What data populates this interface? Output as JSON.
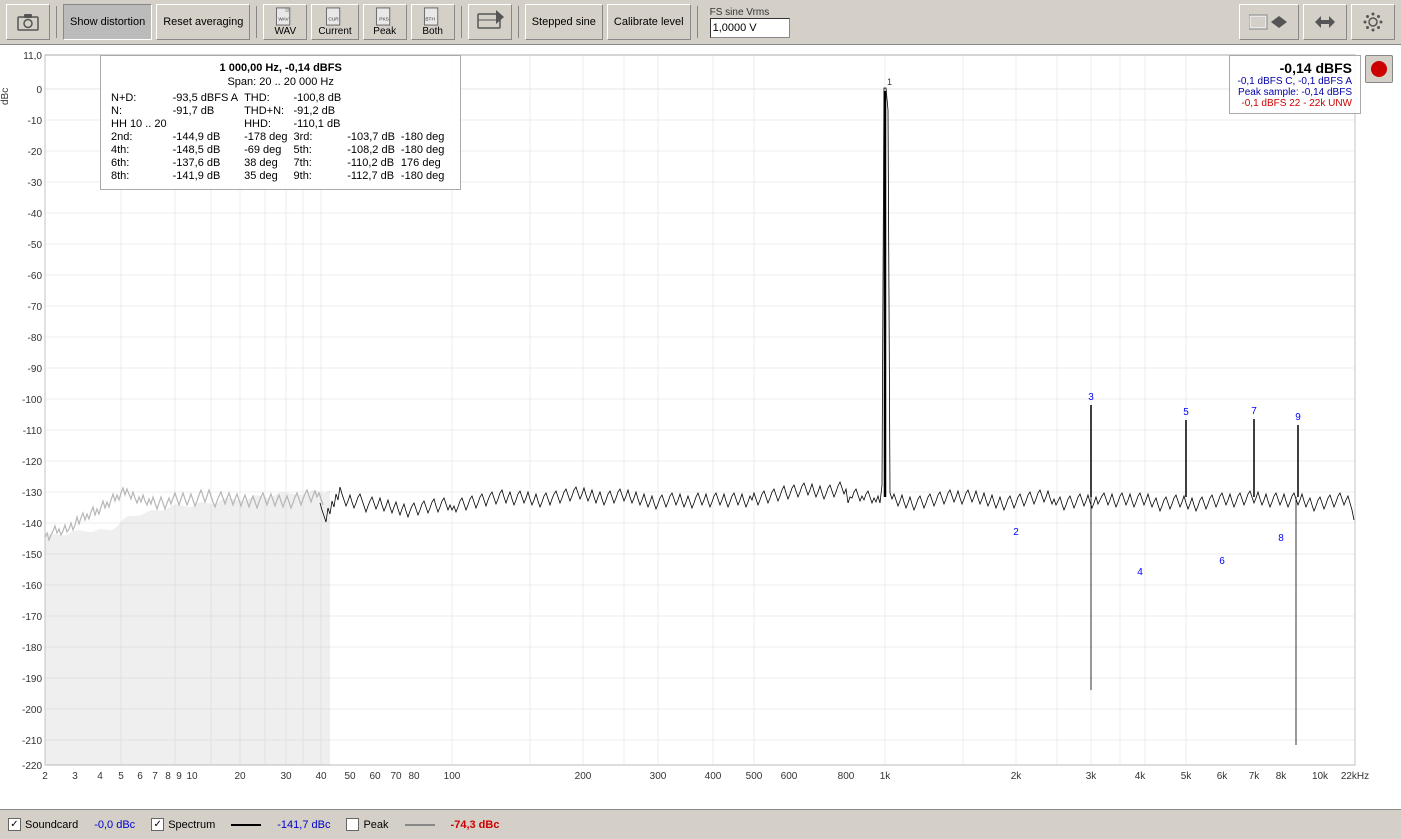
{
  "toolbar": {
    "show_distortion_label": "Show distortion",
    "reset_averaging_label": "Reset averaging",
    "wav_label": "WAV",
    "current_label": "Current",
    "peak_label": "Peak",
    "both_label": "Both",
    "stepped_sine_label": "Stepped sine",
    "calibrate_level_label": "Calibrate level",
    "fs_sine_label": "FS sine Vrms",
    "fs_value": "1,0000 V"
  },
  "info_box": {
    "title": "1 000,00 Hz, -0,14 dBFS",
    "span": "Span: 20 .. 20 000 Hz",
    "nd_label": "N+D:",
    "nd_value": "-93,5 dBFS A",
    "thd_label": "THD:",
    "thd_value": "-100,8 dB",
    "n_label": "N:",
    "n_value": "-91,7 dB",
    "thdn_label": "THD+N:",
    "thdn_value": "-91,2 dB",
    "hh_label": "HH 10 .. 20",
    "hhd_label": "HHD:",
    "hhd_value": "-110,1 dB",
    "harmonics": [
      {
        "label": "2nd:",
        "db": "-144,9 dB",
        "deg": "-178 deg",
        "n_label": "3rd:",
        "n_db": "-103,7 dB",
        "n_deg": "-180 deg"
      },
      {
        "label": "4th:",
        "db": "-148,5 dB",
        "deg": "-69 deg",
        "n_label": "5th:",
        "n_db": "-108,2 dB",
        "n_deg": "-180 deg"
      },
      {
        "label": "6th:",
        "db": "-137,6 dB",
        "deg": "38 deg",
        "n_label": "7th:",
        "n_db": "-110,2 dB",
        "n_deg": "176 deg"
      },
      {
        "label": "8th:",
        "db": "-141,9 dB",
        "deg": "35 deg",
        "n_label": "9th:",
        "n_db": "-112,7 dB",
        "n_deg": "-180 deg"
      }
    ]
  },
  "peak_readout": {
    "main": "-0,14 dBFS",
    "line1": "-0,1 dBFS C, -0,1 dBFS A",
    "line2": "Peak sample: -0,14 dBFS",
    "line3": "-0,1 dBFS 22 - 22k UNW"
  },
  "chart": {
    "y_label": "dBc",
    "y_axis_top": "11,0",
    "y_ticks": [
      "0",
      "-10",
      "-20",
      "-30",
      "-40",
      "-50",
      "-60",
      "-70",
      "-80",
      "-90",
      "-100",
      "-110",
      "-120",
      "-130",
      "-140",
      "-150",
      "-160",
      "-170",
      "-180",
      "-190",
      "-200",
      "-210",
      "-220"
    ],
    "x_ticks": [
      "2",
      "3",
      "4",
      "5",
      "6",
      "7",
      "8",
      "9",
      "10",
      "20",
      "30",
      "40",
      "50",
      "60",
      "70",
      "80",
      "100",
      "200",
      "300",
      "400",
      "500",
      "600",
      "800",
      "1k",
      "2k",
      "3k",
      "4k",
      "5k",
      "6k",
      "7k",
      "8k",
      "10k",
      "22kHz"
    ],
    "harmonic_labels": [
      "2",
      "3",
      "4",
      "5",
      "6",
      "7",
      "8",
      "9"
    ]
  },
  "status_bar": {
    "soundcard_label": "Soundcard",
    "soundcard_checked": true,
    "value1": "-0,0 dBc",
    "spectrum_label": "Spectrum",
    "spectrum_checked": true,
    "value2": "-141,7 dBc",
    "peak_label": "Peak",
    "peak_checked": false,
    "value3": "-74,3 dBc"
  }
}
